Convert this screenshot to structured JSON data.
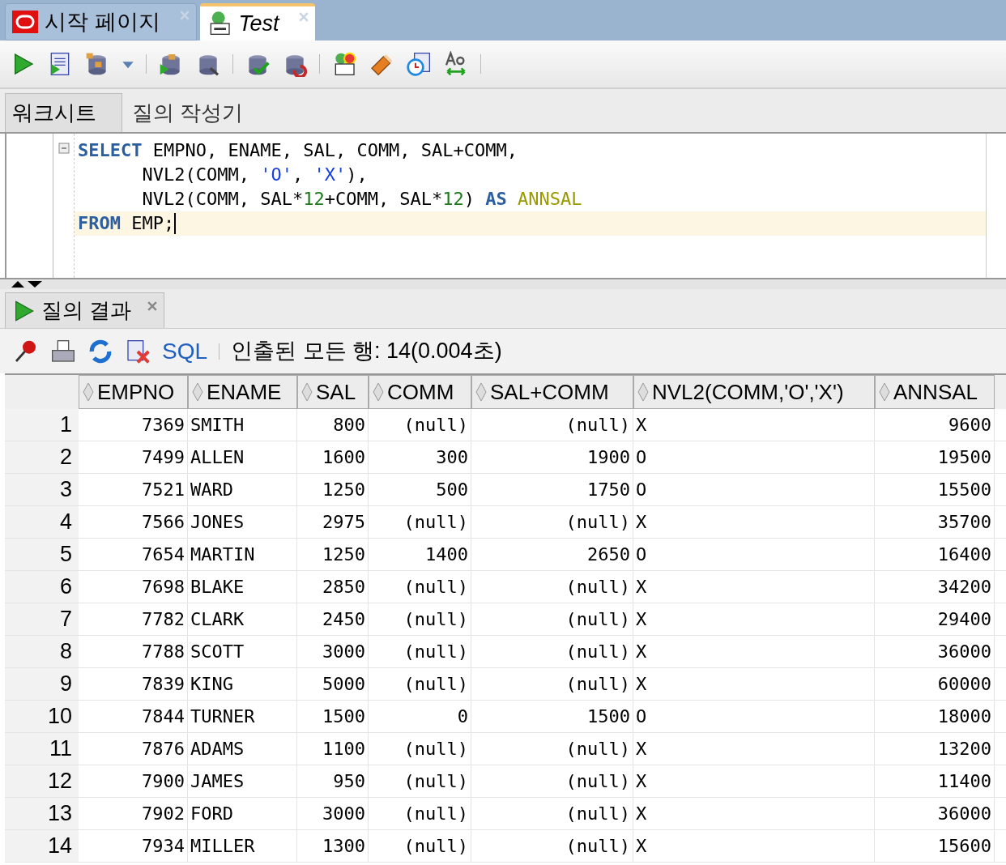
{
  "editor_tabs": [
    {
      "label": "시작 페이지",
      "selected": false
    },
    {
      "label": "Test",
      "selected": true
    }
  ],
  "sub_tabs": [
    {
      "label": "워크시트",
      "selected": true
    },
    {
      "label": "질의 작성기",
      "selected": false
    }
  ],
  "code_lines": [
    {
      "current": false,
      "tokens": [
        {
          "kind": "keyword",
          "text": "SELECT"
        },
        {
          "kind": "plain",
          "text": " EMPNO, ENAME, SAL, COMM, SAL+COMM,"
        }
      ]
    },
    {
      "current": false,
      "tokens": [
        {
          "kind": "plain",
          "text": "      NVL2(COMM, "
        },
        {
          "kind": "string",
          "text": "'O'"
        },
        {
          "kind": "plain",
          "text": ", "
        },
        {
          "kind": "string",
          "text": "'X'"
        },
        {
          "kind": "plain",
          "text": "),"
        }
      ]
    },
    {
      "current": false,
      "tokens": [
        {
          "kind": "plain",
          "text": "      NVL2(COMM, SAL*"
        },
        {
          "kind": "number",
          "text": "12"
        },
        {
          "kind": "plain",
          "text": "+COMM, SAL*"
        },
        {
          "kind": "number",
          "text": "12"
        },
        {
          "kind": "plain",
          "text": ") "
        },
        {
          "kind": "keyword",
          "text": "AS"
        },
        {
          "kind": "alias",
          "text": " ANNSAL"
        }
      ]
    },
    {
      "current": true,
      "tokens": [
        {
          "kind": "keyword",
          "text": "FROM"
        },
        {
          "kind": "plain",
          "text": " EMP;"
        }
      ]
    }
  ],
  "result_tab": {
    "label": "질의 결과"
  },
  "result_toolbar": {
    "sql_link": "SQL",
    "status": "인출된 모든 행: 14(0.004초)"
  },
  "table": {
    "columns": [
      {
        "label": "EMPNO",
        "kind": "number"
      },
      {
        "label": "ENAME",
        "kind": "text"
      },
      {
        "label": "SAL",
        "kind": "number"
      },
      {
        "label": "COMM",
        "kind": "number"
      },
      {
        "label": "SAL+COMM",
        "kind": "number"
      },
      {
        "label": "NVL2(COMM,'O','X')",
        "kind": "text"
      },
      {
        "label": "ANNSAL",
        "kind": "number"
      }
    ],
    "rows": [
      {
        "number": "1",
        "cells": [
          "7369",
          "SMITH",
          "800",
          "(null)",
          "(null)",
          "X",
          "9600"
        ]
      },
      {
        "number": "2",
        "cells": [
          "7499",
          "ALLEN",
          "1600",
          "300",
          "1900",
          "O",
          "19500"
        ]
      },
      {
        "number": "3",
        "cells": [
          "7521",
          "WARD",
          "1250",
          "500",
          "1750",
          "O",
          "15500"
        ]
      },
      {
        "number": "4",
        "cells": [
          "7566",
          "JONES",
          "2975",
          "(null)",
          "(null)",
          "X",
          "35700"
        ]
      },
      {
        "number": "5",
        "cells": [
          "7654",
          "MARTIN",
          "1250",
          "1400",
          "2650",
          "O",
          "16400"
        ]
      },
      {
        "number": "6",
        "cells": [
          "7698",
          "BLAKE",
          "2850",
          "(null)",
          "(null)",
          "X",
          "34200"
        ]
      },
      {
        "number": "7",
        "cells": [
          "7782",
          "CLARK",
          "2450",
          "(null)",
          "(null)",
          "X",
          "29400"
        ]
      },
      {
        "number": "8",
        "cells": [
          "7788",
          "SCOTT",
          "3000",
          "(null)",
          "(null)",
          "X",
          "36000"
        ]
      },
      {
        "number": "9",
        "cells": [
          "7839",
          "KING",
          "5000",
          "(null)",
          "(null)",
          "X",
          "60000"
        ]
      },
      {
        "number": "10",
        "cells": [
          "7844",
          "TURNER",
          "1500",
          "0",
          "1500",
          "O",
          "18000"
        ]
      },
      {
        "number": "11",
        "cells": [
          "7876",
          "ADAMS",
          "1100",
          "(null)",
          "(null)",
          "X",
          "13200"
        ]
      },
      {
        "number": "12",
        "cells": [
          "7900",
          "JAMES",
          "950",
          "(null)",
          "(null)",
          "X",
          "11400"
        ]
      },
      {
        "number": "13",
        "cells": [
          "7902",
          "FORD",
          "3000",
          "(null)",
          "(null)",
          "X",
          "36000"
        ]
      },
      {
        "number": "14",
        "cells": [
          "7934",
          "MILLER",
          "1300",
          "(null)",
          "(null)",
          "X",
          "15600"
        ]
      }
    ]
  }
}
